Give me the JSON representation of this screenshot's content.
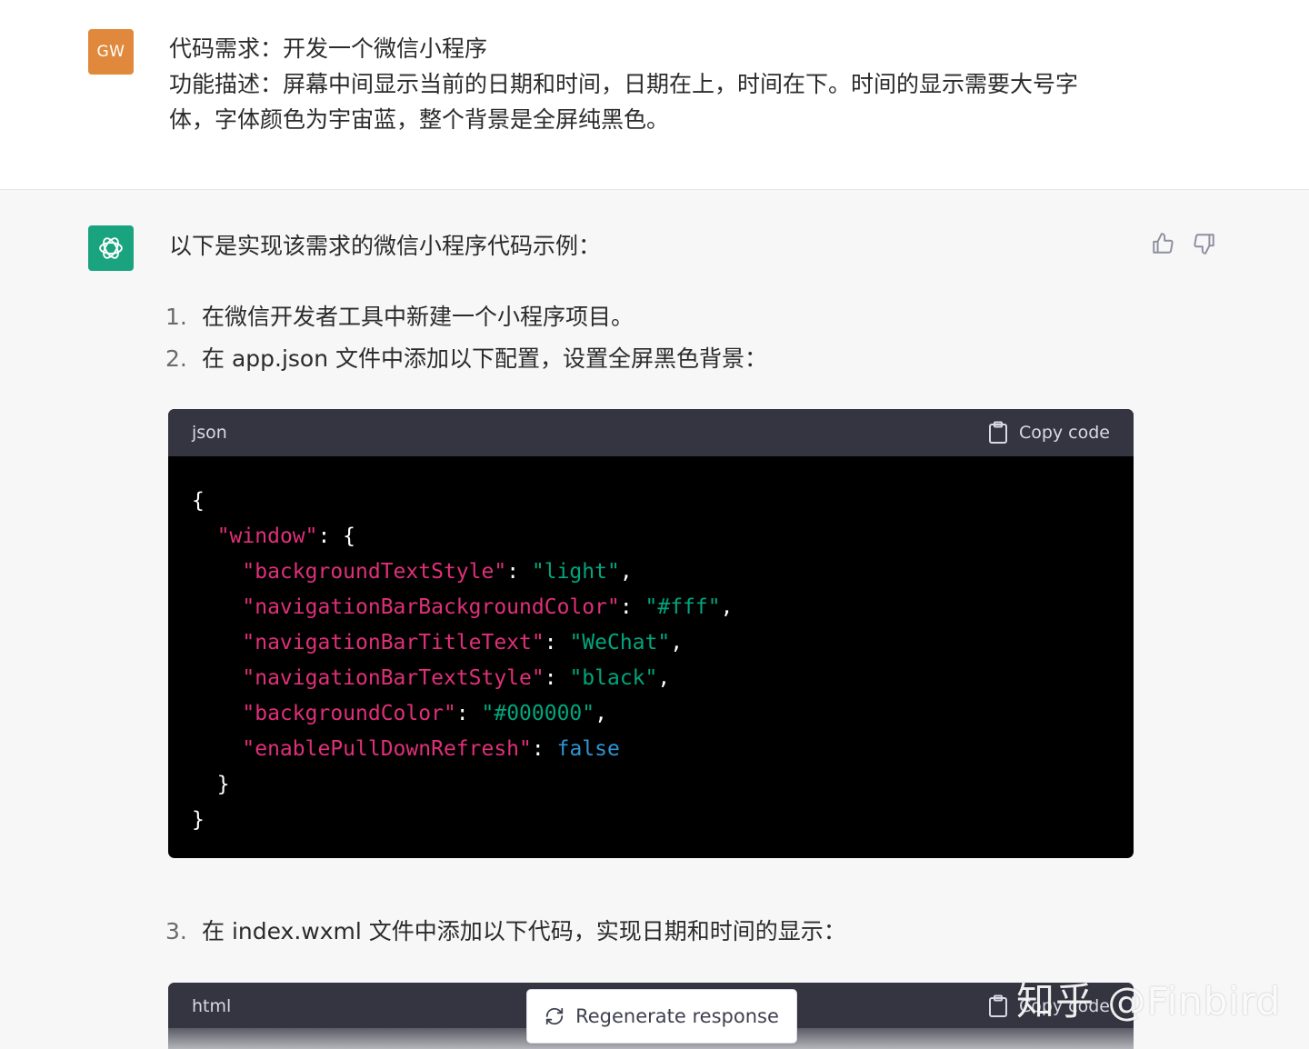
{
  "user_message": {
    "avatar_initials": "GW",
    "avatar_color": "#e0893c",
    "line1": "代码需求：开发一个微信小程序",
    "line2": "功能描述：屏幕中间显示当前的日期和时间，日期在上，时间在下。时间的显示需要大号字",
    "line3": "体，字体颜色为宇宙蓝，整个背景是全屏纯黑色。"
  },
  "assistant_message": {
    "avatar_icon": "openai-logo-icon",
    "avatar_color": "#19a37f",
    "intro": "以下是实现该需求的微信小程序代码示例：",
    "steps": [
      {
        "num": "1.",
        "text": "在微信开发者工具中新建一个小程序项目。"
      },
      {
        "num": "2.",
        "text": "在 app.json 文件中添加以下配置，设置全屏黑色背景："
      },
      {
        "num": "3.",
        "text": "在 index.wxml 文件中添加以下代码，实现日期和时间的显示："
      }
    ],
    "code_blocks": [
      {
        "language": "json",
        "copy_label": "Copy code",
        "lines": [
          [
            {
              "t": "p",
              "v": "{"
            }
          ],
          [
            {
              "t": "p",
              "v": "  "
            },
            {
              "t": "k",
              "v": "\"window\""
            },
            {
              "t": "p",
              "v": ": {"
            }
          ],
          [
            {
              "t": "p",
              "v": "    "
            },
            {
              "t": "k",
              "v": "\"backgroundTextStyle\""
            },
            {
              "t": "p",
              "v": ": "
            },
            {
              "t": "s",
              "v": "\"light\""
            },
            {
              "t": "p",
              "v": ","
            }
          ],
          [
            {
              "t": "p",
              "v": "    "
            },
            {
              "t": "k",
              "v": "\"navigationBarBackgroundColor\""
            },
            {
              "t": "p",
              "v": ": "
            },
            {
              "t": "s",
              "v": "\"#fff\""
            },
            {
              "t": "p",
              "v": ","
            }
          ],
          [
            {
              "t": "p",
              "v": "    "
            },
            {
              "t": "k",
              "v": "\"navigationBarTitleText\""
            },
            {
              "t": "p",
              "v": ": "
            },
            {
              "t": "s",
              "v": "\"WeChat\""
            },
            {
              "t": "p",
              "v": ","
            }
          ],
          [
            {
              "t": "p",
              "v": "    "
            },
            {
              "t": "k",
              "v": "\"navigationBarTextStyle\""
            },
            {
              "t": "p",
              "v": ": "
            },
            {
              "t": "s",
              "v": "\"black\""
            },
            {
              "t": "p",
              "v": ","
            }
          ],
          [
            {
              "t": "p",
              "v": "    "
            },
            {
              "t": "k",
              "v": "\"backgroundColor\""
            },
            {
              "t": "p",
              "v": ": "
            },
            {
              "t": "s",
              "v": "\"#000000\""
            },
            {
              "t": "p",
              "v": ","
            }
          ],
          [
            {
              "t": "p",
              "v": "    "
            },
            {
              "t": "k",
              "v": "\"enablePullDownRefresh\""
            },
            {
              "t": "p",
              "v": ": "
            },
            {
              "t": "b",
              "v": "false"
            }
          ],
          [
            {
              "t": "p",
              "v": "  }"
            }
          ],
          [
            {
              "t": "p",
              "v": "}"
            }
          ]
        ]
      },
      {
        "language": "html",
        "copy_label": "Copy code"
      }
    ],
    "feedback": {
      "up_icon": "thumbs-up-icon",
      "down_icon": "thumbs-down-icon"
    }
  },
  "regenerate_label": "Regenerate response",
  "watermark": "知乎 @Finbird",
  "colors": {
    "code_key": "#df3079",
    "code_string": "#00a67d",
    "code_bool": "#2e95d3",
    "code_header_bg": "#343541"
  }
}
